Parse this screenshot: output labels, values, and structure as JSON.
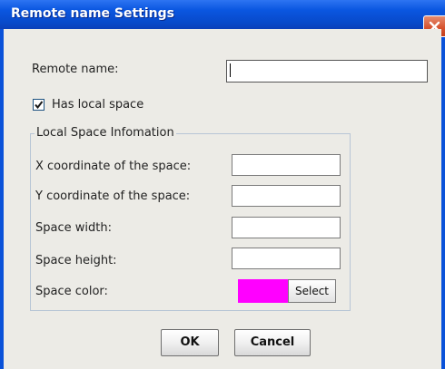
{
  "window": {
    "title": "Remote name Settings"
  },
  "form": {
    "remote_name_label": "Remote name:",
    "remote_name_value": "",
    "has_local_space_label": "Has local space",
    "has_local_space_checked": true
  },
  "local_space": {
    "group_title": "Local Space Infomation",
    "x_label": "X coordinate of the space:",
    "x_value": "",
    "y_label": "Y coordinate of the space:",
    "y_value": "",
    "width_label": "Space width:",
    "width_value": "",
    "height_label": "Space height:",
    "height_value": "",
    "color_label": "Space color:",
    "color_value": "#ff00ff",
    "select_label": "Select"
  },
  "buttons": {
    "ok_label": "OK",
    "cancel_label": "Cancel"
  },
  "icons": {
    "close": "close-icon",
    "check": "checkmark-icon"
  }
}
